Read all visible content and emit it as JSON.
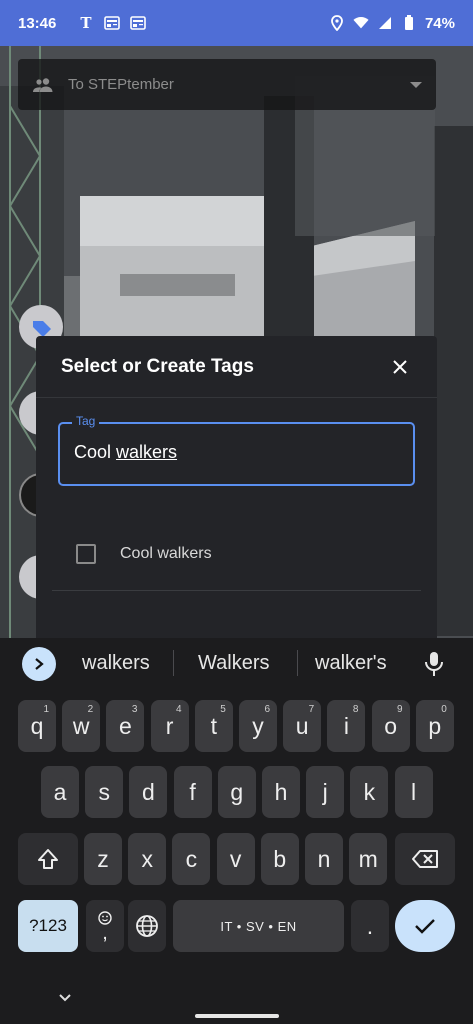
{
  "status_bar": {
    "time": "13:46",
    "battery": "74%"
  },
  "project_select": {
    "label": "To STEPtember"
  },
  "dialog": {
    "title": "Select or Create Tags",
    "field_label": "Tag",
    "input_prefix": "Cool ",
    "input_underlined": "walkers",
    "option_label": "Cool walkers"
  },
  "keyboard": {
    "suggestions": [
      "walkers",
      "Walkers",
      "walker's"
    ],
    "row1": [
      {
        "k": "q",
        "n": "1"
      },
      {
        "k": "w",
        "n": "2"
      },
      {
        "k": "e",
        "n": "3"
      },
      {
        "k": "r",
        "n": "4"
      },
      {
        "k": "t",
        "n": "5"
      },
      {
        "k": "y",
        "n": "6"
      },
      {
        "k": "u",
        "n": "7"
      },
      {
        "k": "i",
        "n": "8"
      },
      {
        "k": "o",
        "n": "9"
      },
      {
        "k": "p",
        "n": "0"
      }
    ],
    "row2": [
      "a",
      "s",
      "d",
      "f",
      "g",
      "h",
      "j",
      "k",
      "l"
    ],
    "row3": [
      "z",
      "x",
      "c",
      "v",
      "b",
      "n",
      "m"
    ],
    "symbols_label": "?123",
    "comma_label": ",",
    "space_label": "IT • SV • EN",
    "period_label": ".",
    "accent_color": "#c9e2fb"
  }
}
